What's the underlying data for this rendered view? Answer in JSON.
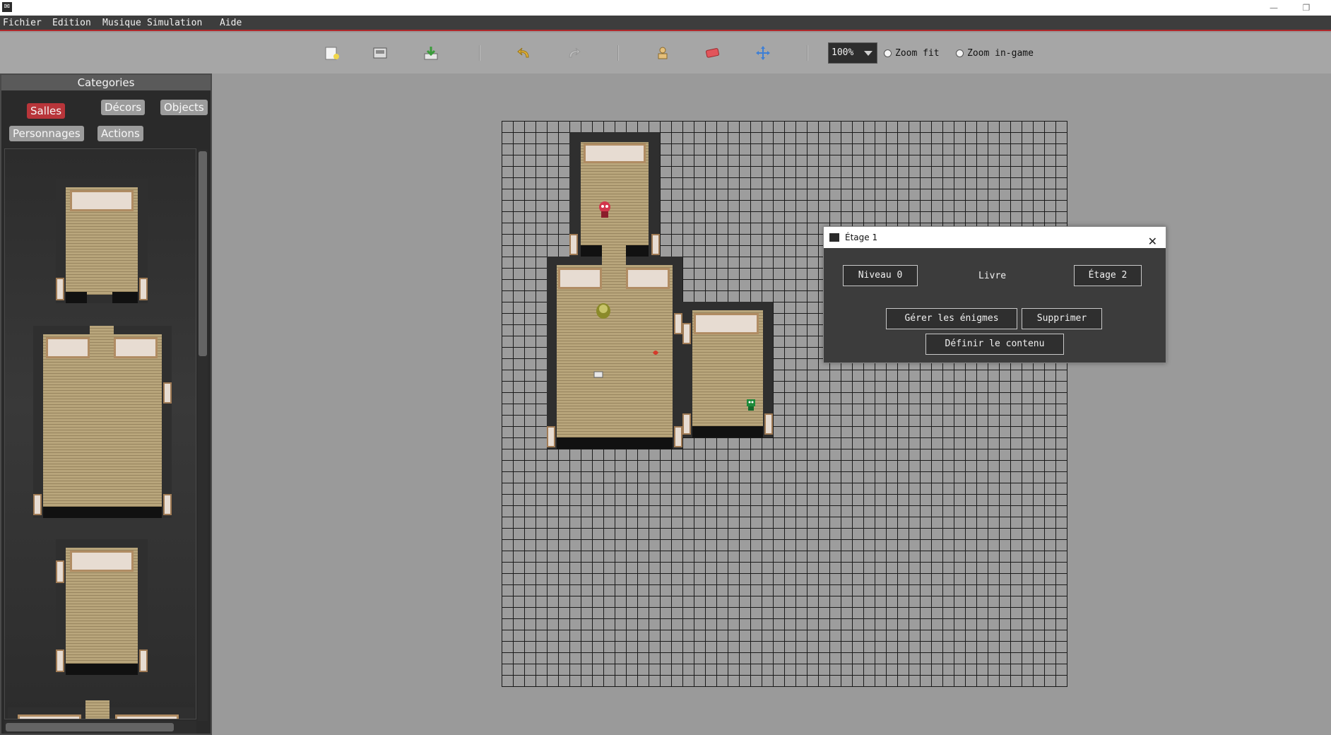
{
  "window": {
    "minimize": "—",
    "restore": "❐"
  },
  "menu": [
    "Fichier",
    "Edition",
    "Musique",
    "Simulation",
    "Aide"
  ],
  "toolbar": {
    "tools": [
      "new-icon",
      "open-icon",
      "save-icon",
      "undo-icon",
      "redo-icon",
      "character-icon",
      "eraser-icon",
      "move-icon"
    ],
    "zoom_value": "100%",
    "zoom_fit_label": "Zoom fit",
    "zoom_ingame_label": "Zoom in-game"
  },
  "sidebar": {
    "header": "Categories",
    "categories": [
      "Salles",
      "Décors",
      "Objects",
      "Personnages",
      "Actions"
    ],
    "active_category": "Salles"
  },
  "dialog": {
    "title": "Étage 1",
    "prev_button": "Niveau 0",
    "current_label": "Livre",
    "next_button": "Étage 2",
    "manage_button": "Gérer les énigmes",
    "delete_button": "Supprimer",
    "content_button": "Définir le contenu"
  },
  "colors": {
    "accent": "#b8353a",
    "menu_bg": "#3d3d3d",
    "floor": "#b8a57b",
    "wall": "#2f2f2f"
  }
}
